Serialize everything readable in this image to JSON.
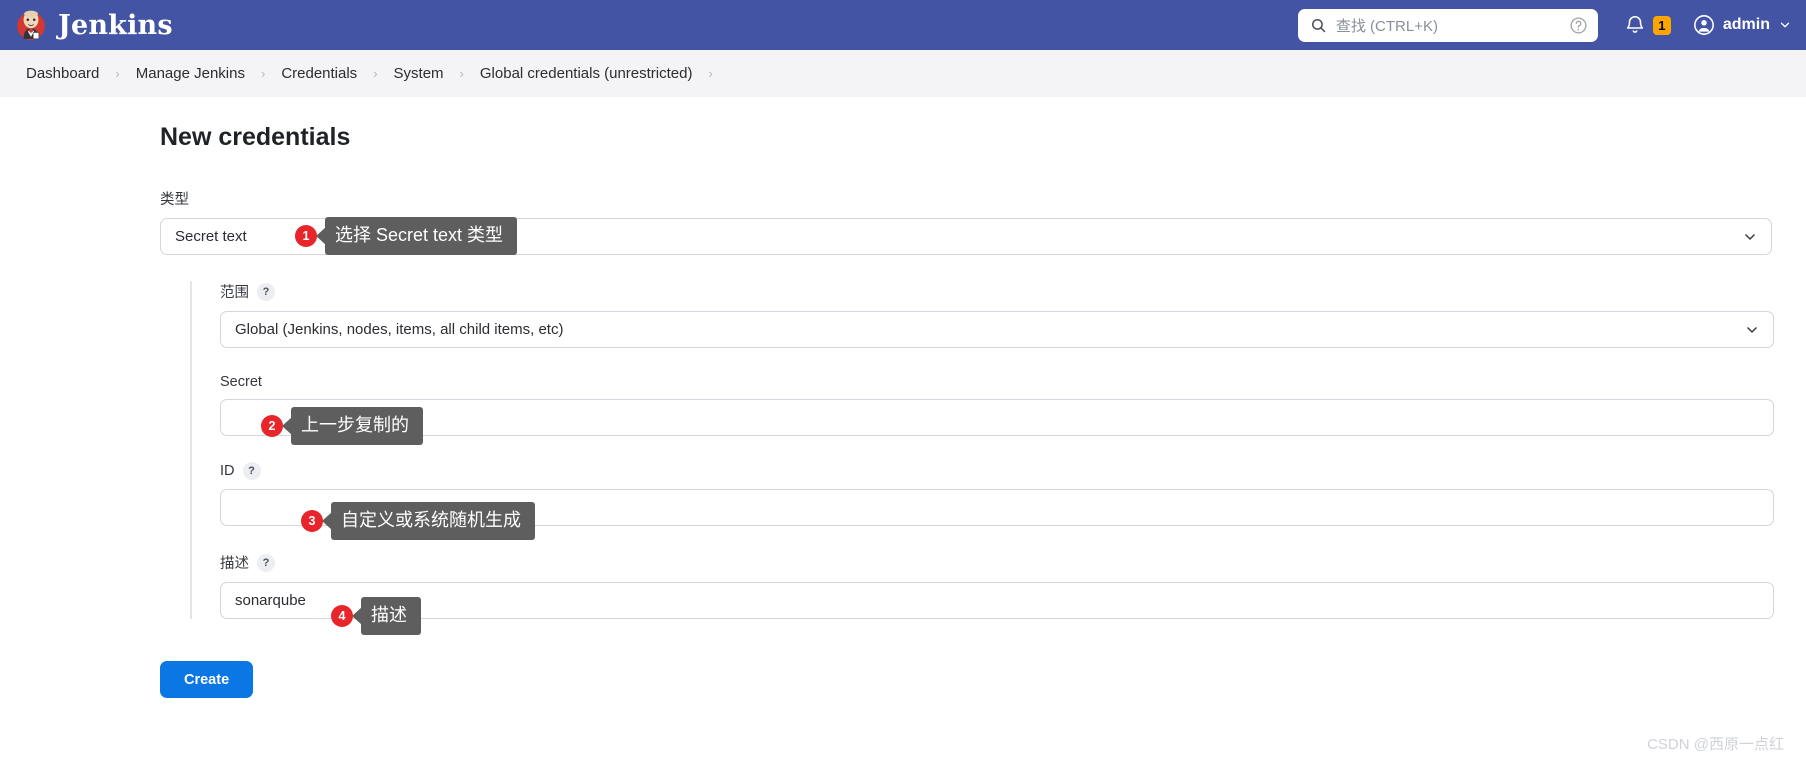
{
  "header": {
    "brand": "Jenkins",
    "brand_logo_icon": "jenkins-butler-logo",
    "search": {
      "placeholder": "查找 (CTRL+K)",
      "value": "",
      "icon": "search-icon",
      "help_icon": "question-circle-icon"
    },
    "notifications": {
      "icon": "bell-icon",
      "count": "1",
      "badge_color": "#ffa500"
    },
    "user": {
      "name": "admin",
      "avatar_icon": "user-circle-icon",
      "caret_icon": "chevron-down-icon"
    },
    "background_color": "#4354a5"
  },
  "breadcrumbs": {
    "separator": "›",
    "items": [
      {
        "label": "Dashboard"
      },
      {
        "label": "Manage Jenkins"
      },
      {
        "label": "Credentials"
      },
      {
        "label": "System"
      },
      {
        "label": "Global credentials (unrestricted)"
      }
    ]
  },
  "main": {
    "title": "New credentials",
    "type_field": {
      "label": "类型",
      "value": "Secret text",
      "chevron_icon": "chevron-down-icon"
    },
    "scope_field": {
      "label": "范围",
      "help": "?",
      "value": "Global (Jenkins, nodes, items, all child items, etc)",
      "chevron_icon": "chevron-down-icon"
    },
    "secret_field": {
      "label": "Secret",
      "value": "",
      "placeholder": ""
    },
    "id_field": {
      "label": "ID",
      "help": "?",
      "value": "",
      "placeholder": ""
    },
    "description_field": {
      "label": "描述",
      "help": "?",
      "value": "sonarqube",
      "placeholder": ""
    },
    "create_button": {
      "label": "Create",
      "color": "#0b77e5"
    }
  },
  "annotations": [
    {
      "number": "1",
      "text": "选择 Secret text 类型"
    },
    {
      "number": "2",
      "text": "上一步复制的"
    },
    {
      "number": "3",
      "text": "自定义或系统随机生成"
    },
    {
      "number": "4",
      "text": "描述"
    }
  ],
  "watermark": "CSDN @西原一点红"
}
